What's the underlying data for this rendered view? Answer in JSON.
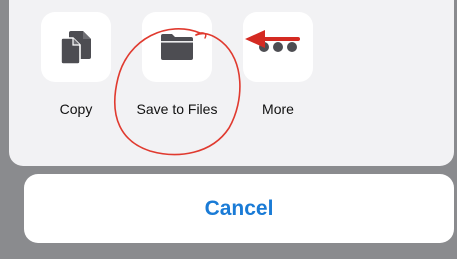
{
  "share_sheet": {
    "actions": [
      {
        "label": "Copy",
        "icon": "copy-icon"
      },
      {
        "label": "Save to Files",
        "icon": "folder-icon"
      },
      {
        "label": "More",
        "icon": "ellipsis-icon"
      }
    ],
    "cancel_label": "Cancel"
  },
  "annotations": {
    "circle_color": "#e03a2f",
    "arrow_color": "#d42a22"
  },
  "colors": {
    "accent": "#1a7bd6",
    "icon": "#4d4d52",
    "sheet": "#f2f2f4",
    "backdrop": "#8a8b8e"
  }
}
